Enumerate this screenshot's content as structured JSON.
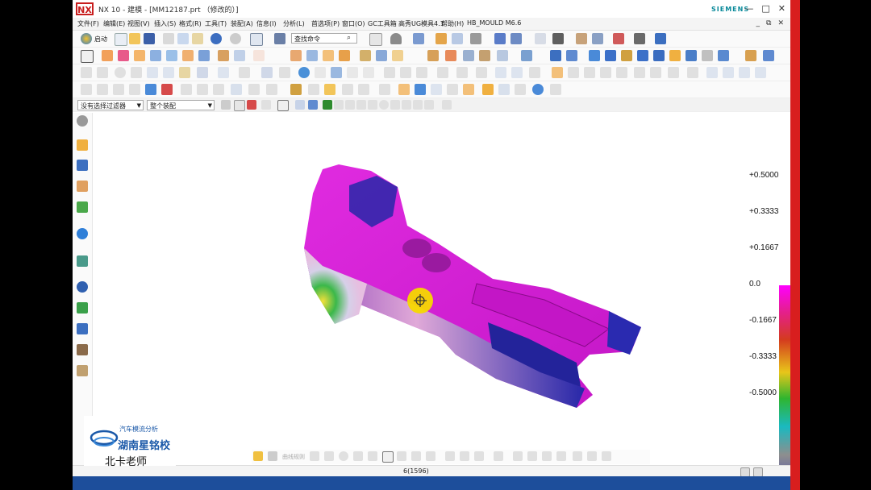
{
  "window": {
    "logo_text": "NX",
    "title": "NX 10 - 建模 - [MM12187.prt （修改的）]",
    "brand": "SIEMENS",
    "controls": [
      "—",
      "□",
      "✕"
    ],
    "subcontrols": [
      "_",
      "⧉",
      "✕"
    ]
  },
  "menubar": {
    "items": [
      "文件(F)",
      "编辑(E)",
      "视图(V)",
      "插入(S)",
      "格式(R)",
      "工具(T)",
      "装配(A)",
      "信息(I)",
      "分析(L)",
      "首选项(P)",
      "窗口(O)",
      "GC工具箱",
      "高秀UG模具4.1",
      "帮助(H)",
      "HB_MOULD M6.6"
    ]
  },
  "toolbar": {
    "start_label": "启动",
    "search_placeholder": "查找命令",
    "filter_select": "没有选择过滤器",
    "assembly_select": "整个装配"
  },
  "legend": {
    "ticks": [
      "+0.5000",
      "+0.3333",
      "+0.1667",
      "0.0",
      "-0.1667",
      "-0.3333",
      "-0.5000"
    ],
    "colors": [
      "#ff00ff",
      "#e81aa0",
      "#d43b1e",
      "#e8c61a",
      "#2fb52f",
      "#1ab9c0",
      "#8e8e8e",
      "#2b2bbf"
    ]
  },
  "status": {
    "text": "6(1596)"
  },
  "snapbar": {
    "label": "曲线规则"
  },
  "watermark": {
    "line1": "汽车模流分析",
    "line2": "湖南星铭校",
    "line3": "北卡老师"
  },
  "icons": {
    "left_rail": [
      "settings-icon",
      "constraint-icon",
      "assembly-icon",
      "feature-tree-icon",
      "reuse-library-icon",
      "web-browser-icon",
      "part-icon",
      "history-icon",
      "role-icon",
      "analysis-icon",
      "hd3d-icon",
      "palette-icon"
    ],
    "right_rail": [
      "view-cube-icon",
      "render-style-icon",
      "shaded-icon",
      "wrench-icon"
    ]
  }
}
